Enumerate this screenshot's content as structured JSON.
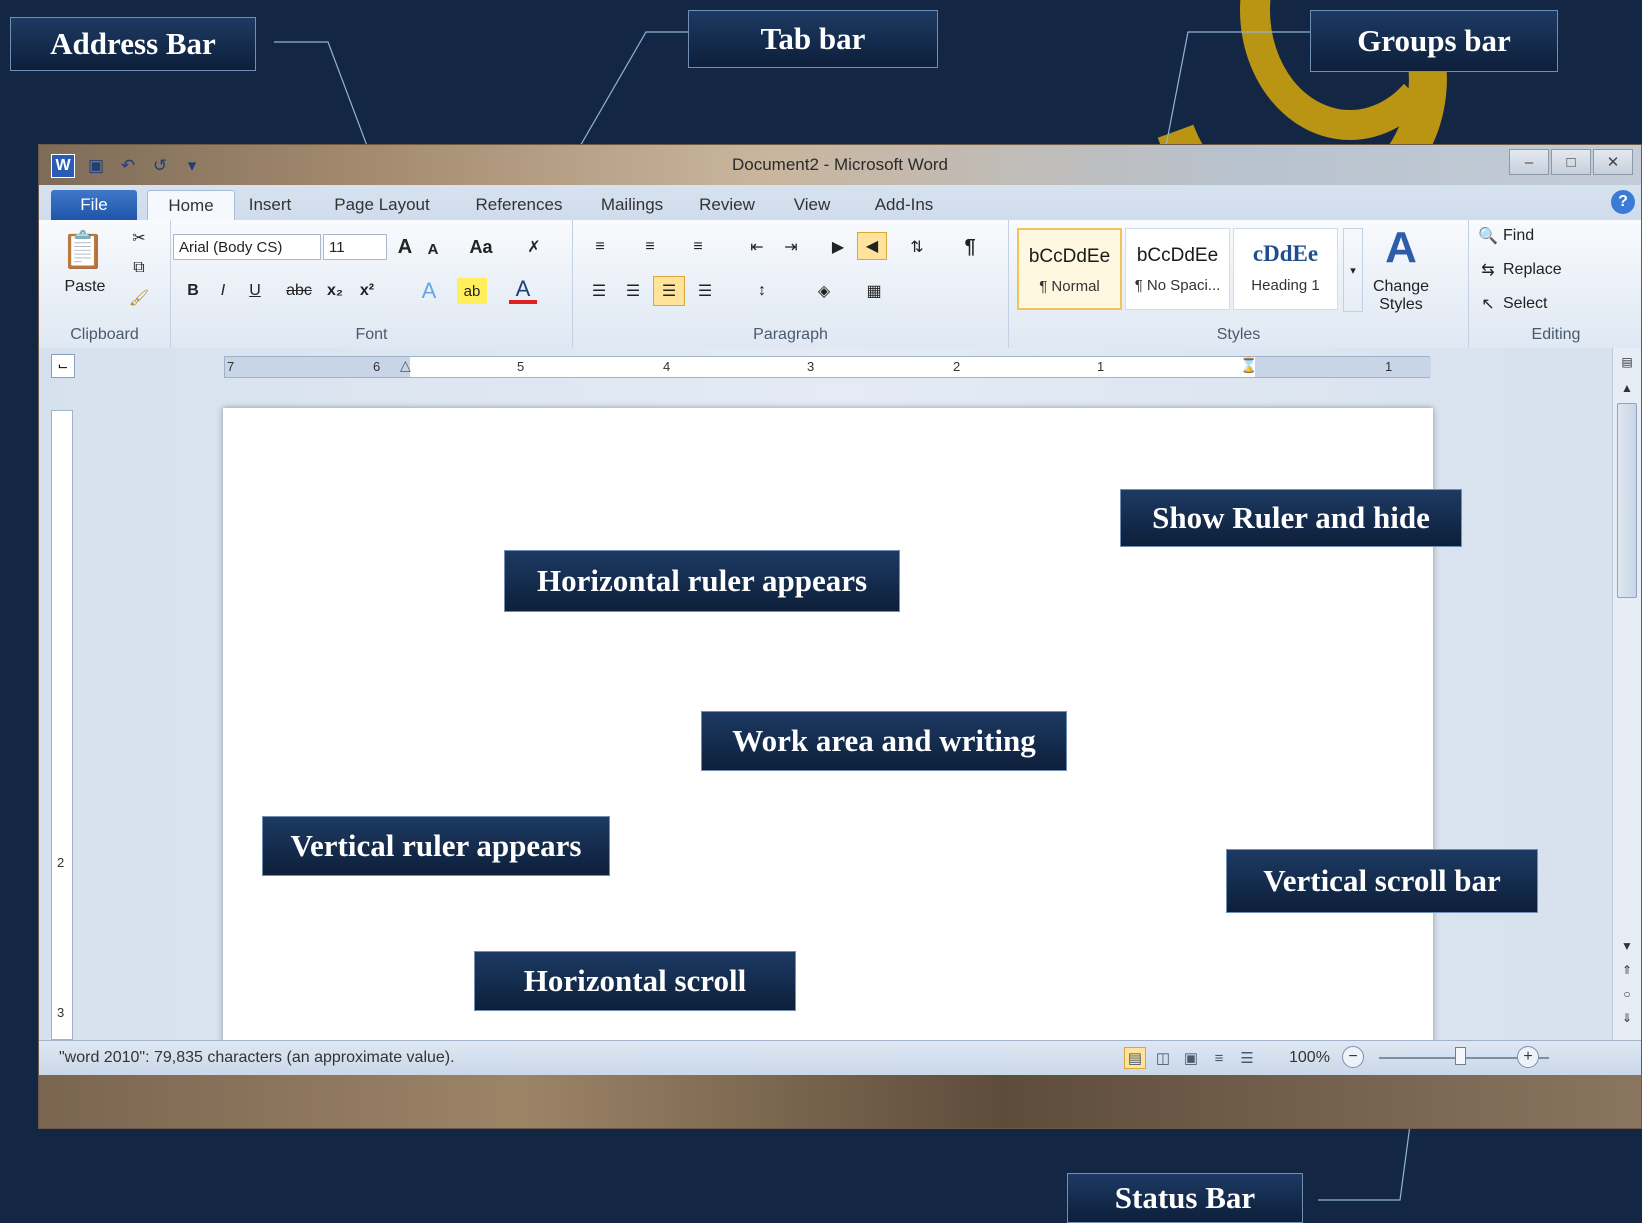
{
  "colors": {
    "background": "#132745",
    "callout": "#1d3a63",
    "accent": "#b99513"
  },
  "callouts": {
    "address_bar": "Address Bar",
    "tab_bar": "Tab bar",
    "groups_bar": "Groups bar",
    "show_ruler": "Show Ruler and hide",
    "horizontal_ruler": "Horizontal ruler appears",
    "work_area": "Work area and writing",
    "vertical_ruler": "Vertical ruler appears",
    "vertical_scroll": "Vertical scroll bar",
    "horizontal_scroll": "Horizontal scroll",
    "status_bar": "Status Bar"
  },
  "window": {
    "title": "Document2 - Microsoft Word",
    "qat_icons": [
      "word-logo-icon",
      "save-icon",
      "undo-icon",
      "redo-icon",
      "customize-qat-icon"
    ],
    "controls": {
      "minimize": "–",
      "maximize": "□",
      "close": "✕"
    }
  },
  "tabs": [
    "File",
    "Home",
    "Insert",
    "Page Layout",
    "References",
    "Mailings",
    "Review",
    "View",
    "Add-Ins"
  ],
  "ribbon": {
    "clipboard": {
      "label": "Clipboard",
      "paste": "Paste"
    },
    "font": {
      "label": "Font",
      "family": "Arial (Body CS)",
      "size": "11",
      "grow": "A",
      "shrink": "A",
      "case": "Aa",
      "bold": "B",
      "italic": "I",
      "underline": "U",
      "strike": "abc",
      "subscript": "x₂",
      "superscript": "x²"
    },
    "paragraph": {
      "label": "Paragraph",
      "show_marks": "¶"
    },
    "styles": {
      "label": "Styles",
      "items": [
        {
          "sample": "bCcDdEe",
          "name": "¶ Normal"
        },
        {
          "sample": "bCcDdEe",
          "name": "¶ No Spaci..."
        },
        {
          "sample": "cDdEe",
          "name": "Heading 1"
        }
      ],
      "change": "Change Styles"
    },
    "editing": {
      "label": "Editing",
      "find": "Find",
      "replace": "Replace",
      "select": "Select"
    }
  },
  "ruler": {
    "h_numbers": [
      "7",
      "6",
      "5",
      "4",
      "3",
      "2",
      "1",
      "1"
    ],
    "v_numbers": [
      "2",
      "3"
    ]
  },
  "status": {
    "text": "\"word 2010\": 79,835 characters (an approximate value).",
    "zoom": "100%",
    "zoom_fraction": 0.5
  }
}
